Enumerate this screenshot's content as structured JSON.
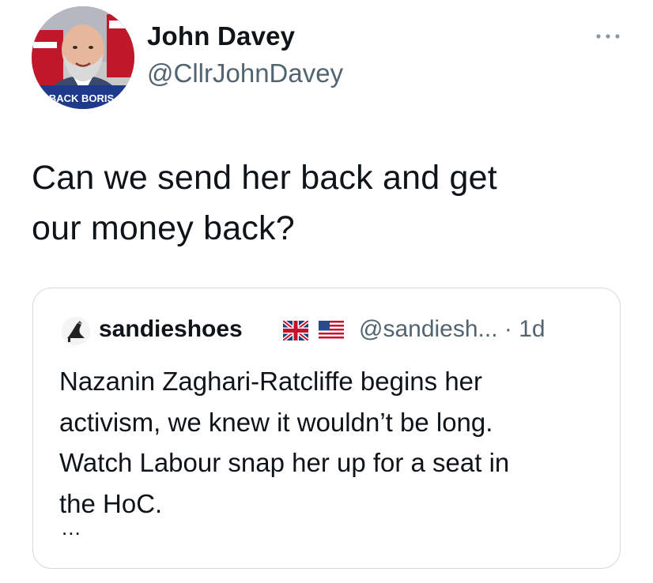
{
  "author": {
    "display_name": "John Davey",
    "handle": "@CllrJohnDavey",
    "avatar_badge": "BACK BORIS"
  },
  "tweet": {
    "text_line1": "Can we send her back and get",
    "text_line2": "our money back?"
  },
  "quoted_tweet": {
    "display_name": "sandieshoes",
    "flags": [
      "uk-flag-icon",
      "us-flag-icon"
    ],
    "meta": "@sandiesh... · 1d",
    "text_line1": "Nazanin Zaghari-Ratcliffe begins her",
    "text_line2": "activism, we knew it wouldn’t be long.",
    "text_line3": "Watch Labour snap her up for a seat in",
    "text_line4": "the HoC.",
    "more": "..."
  },
  "colors": {
    "text": "#0f1419",
    "secondary_text": "#536471",
    "border": "#cfd9de",
    "badge_bg": "#1f3a8a"
  }
}
